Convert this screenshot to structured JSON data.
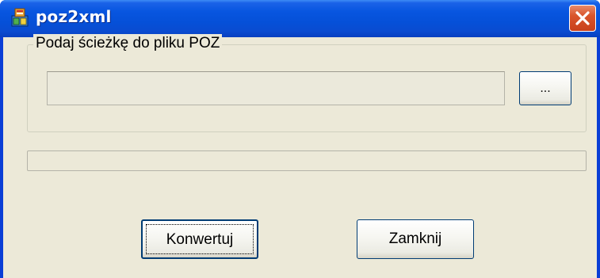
{
  "window": {
    "title": "poz2xml",
    "app_icon": "poz2xml-app-icon",
    "close_icon": "close-icon"
  },
  "group": {
    "label": "Podaj ścieżkę do pliku POZ"
  },
  "path_input": {
    "value": "",
    "placeholder": ""
  },
  "browse_button": {
    "label": "..."
  },
  "progress": {
    "value": 0
  },
  "buttons": {
    "convert_label": "Konwertuj",
    "close_label": "Zamknij"
  },
  "colors": {
    "titlebar": "#0a52dc",
    "client_bg": "#ece9d8",
    "close_button": "#d9552c",
    "button_border": "#003c74"
  }
}
